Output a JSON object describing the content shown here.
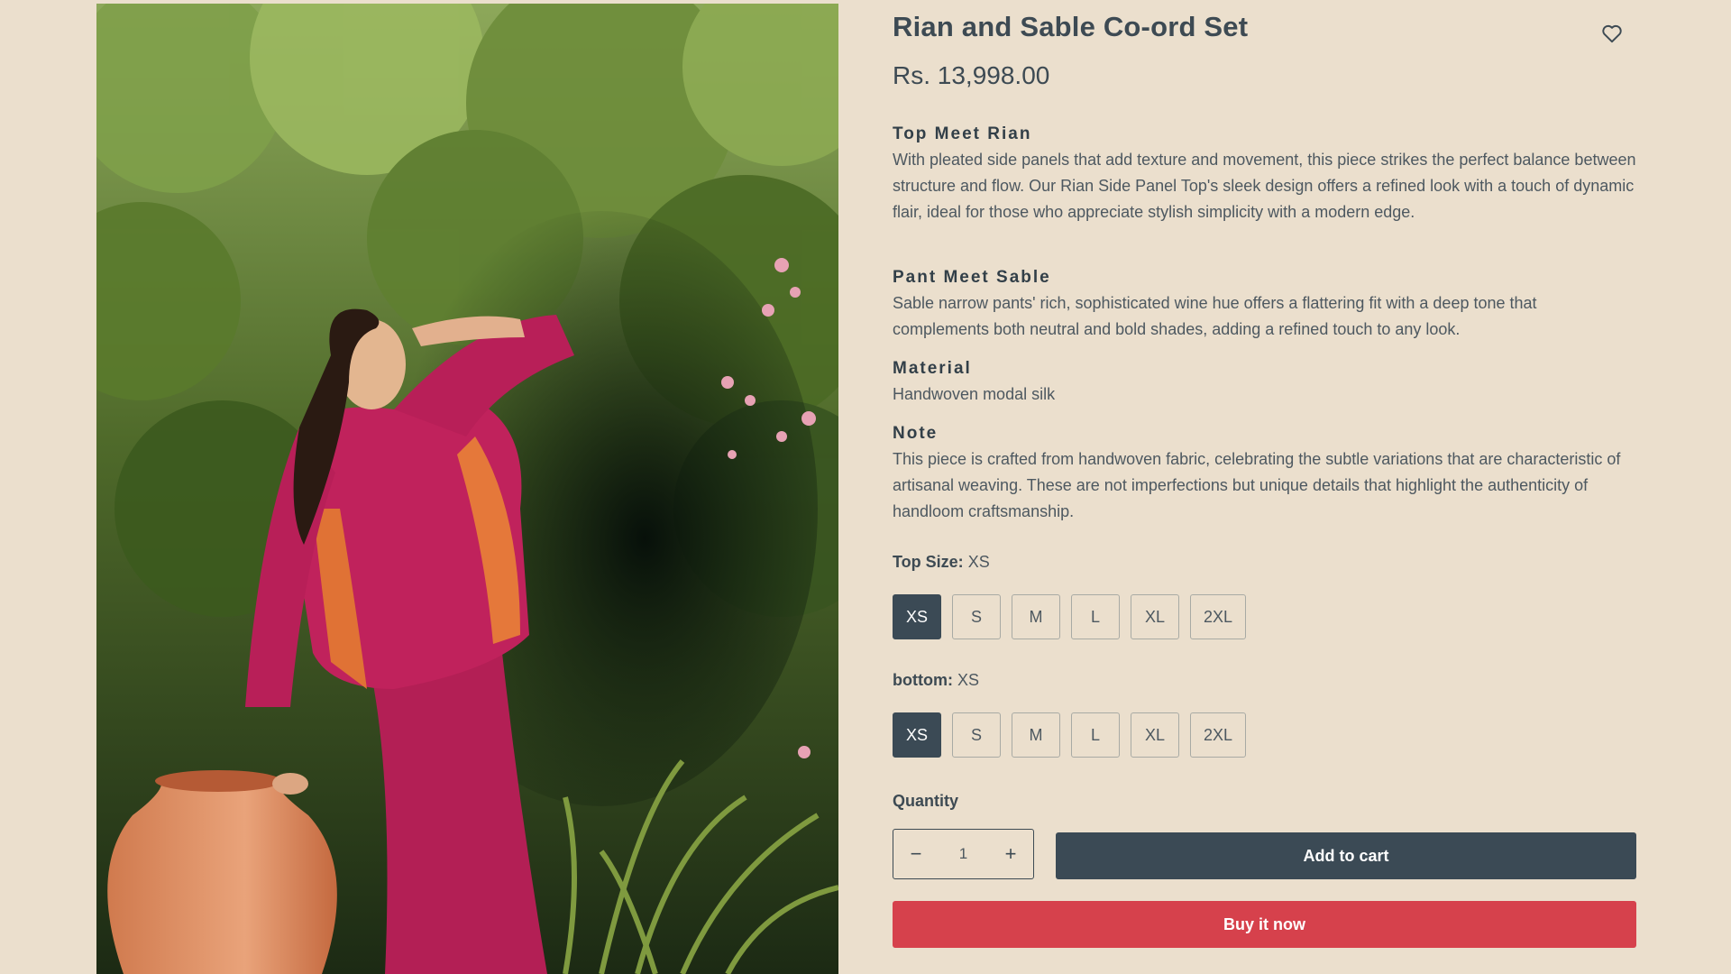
{
  "product": {
    "title": "Rian and Sable Co-ord Set",
    "price": "Rs. 13,998.00",
    "wishlist_icon": "heart-icon",
    "image_alt": "Model in magenta co-ord set in a garden beside a terracotta pot"
  },
  "description": [
    {
      "heading": "Top Meet Rian",
      "text": "With pleated side panels that add texture and movement, this piece strikes the perfect balance between structure and flow. Our Rian Side Panel Top's sleek design offers a refined look with a touch of dynamic flair, ideal for those who appreciate stylish simplicity with a modern edge."
    },
    {
      "heading": "Pant Meet Sable",
      "text": "Sable narrow pants' rich, sophisticated wine hue offers a flattering fit with a deep tone that complements both neutral and bold shades, adding a refined touch to any look."
    },
    {
      "heading": "Material",
      "text": "Handwoven modal silk"
    },
    {
      "heading": "Note",
      "text": "This piece is crafted from handwoven fabric, celebrating the subtle variations that are characteristic of artisanal weaving. These are not imperfections but unique details that highlight the authenticity of handloom craftsmanship."
    }
  ],
  "options": {
    "top": {
      "label": "Top Size:",
      "selected": "XS",
      "sizes": [
        "XS",
        "S",
        "M",
        "L",
        "XL",
        "2XL"
      ]
    },
    "bottom": {
      "label": "bottom:",
      "selected": "XS",
      "sizes": [
        "XS",
        "S",
        "M",
        "L",
        "XL",
        "2XL"
      ]
    }
  },
  "quantity": {
    "label": "Quantity",
    "value": "1",
    "minus": "−",
    "plus": "+"
  },
  "actions": {
    "add_to_cart": "Add to cart",
    "buy_now": "Buy it now"
  },
  "colors": {
    "background": "#ebdfcd",
    "primary": "#3b4a55",
    "buy_now": "#d6414c"
  }
}
